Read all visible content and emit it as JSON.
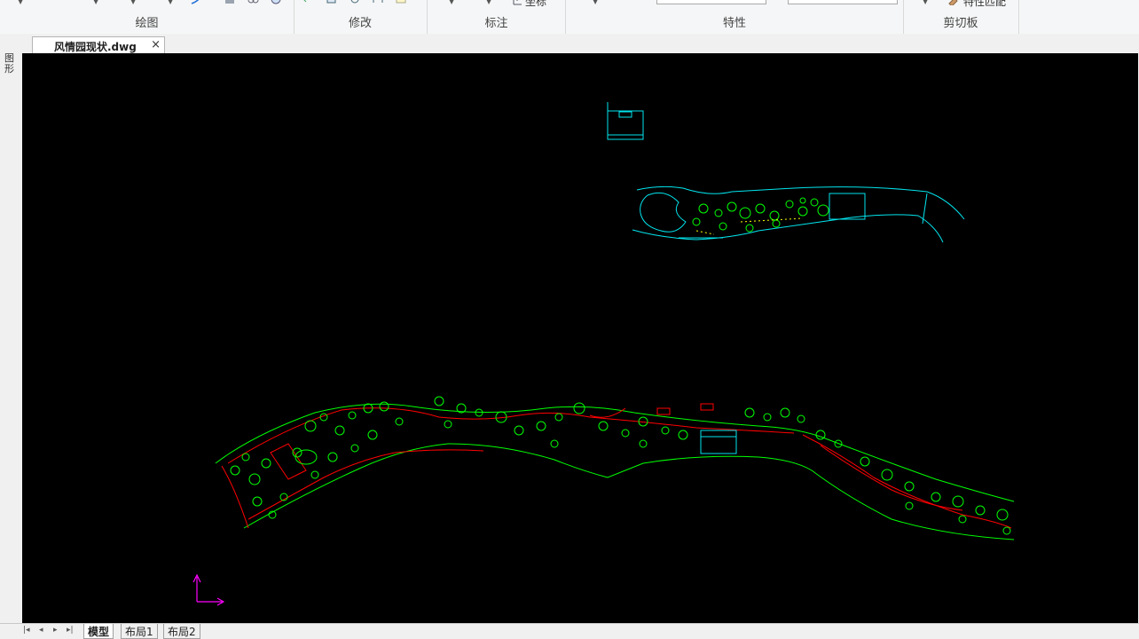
{
  "ribbon": {
    "panels": [
      {
        "title": "绘图"
      },
      {
        "title": "修改"
      },
      {
        "title": "标注"
      },
      {
        "title": "特性"
      },
      {
        "title": "剪切板"
      }
    ],
    "dimension_partial_label": "坐标",
    "clipboard_partial_label": "特性匹配"
  },
  "sidebar": {
    "vertical_label": "图形"
  },
  "document_tab": {
    "label": "风情园现状.dwg",
    "close": "×"
  },
  "layout_tabs": [
    {
      "label": "模型",
      "active": true
    },
    {
      "label": "布局1",
      "active": false
    },
    {
      "label": "布局2",
      "active": false
    }
  ],
  "nav_buttons": [
    "|◂",
    "◂",
    "▸",
    "▸|"
  ],
  "colors": {
    "canvas": "#000000",
    "cyan": "#00e5ee",
    "green": "#00ff00",
    "red": "#ff0000",
    "yellow": "#ffff00",
    "ucs": "#ff00ff"
  }
}
